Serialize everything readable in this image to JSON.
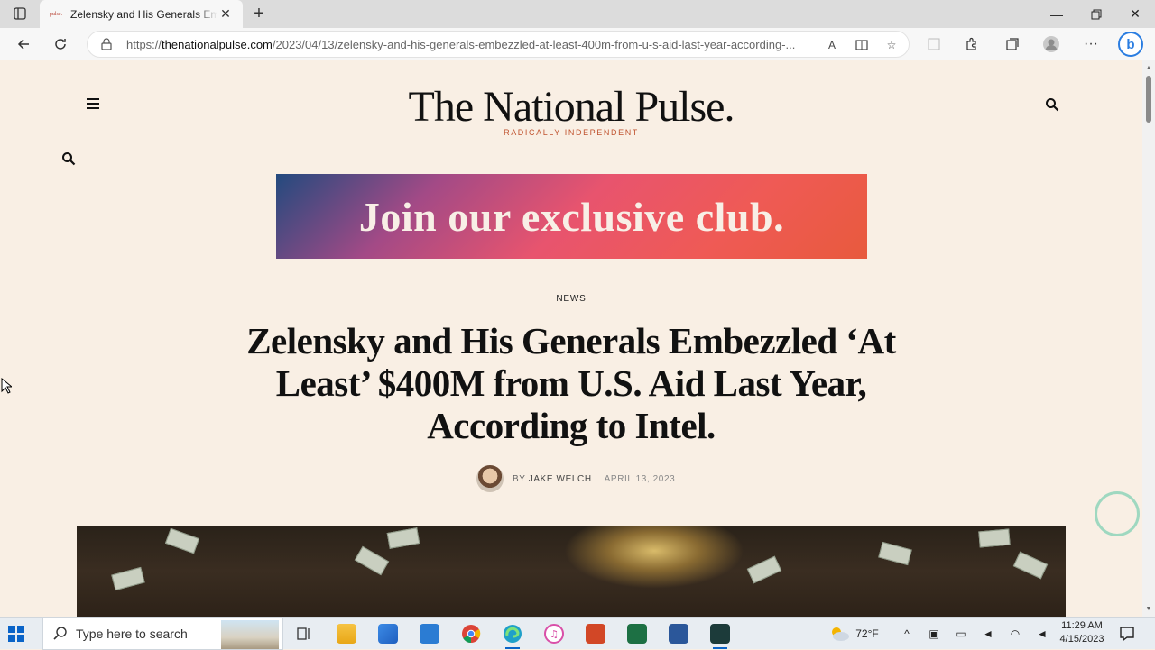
{
  "browser": {
    "tab": {
      "favicon_text": "pulse.",
      "title": "Zelensky and His Generals Embezzled"
    },
    "address": {
      "url_prefix": "https://",
      "url_domain": "thenationalpulse.com",
      "url_path": "/2023/04/13/zelensky-and-his-generals-embezzled-at-least-400m-from-u-s-aid-last-year-according-..."
    }
  },
  "page": {
    "logo": "The National Pulse.",
    "tagline": "RADICALLY INDEPENDENT",
    "banner_text": "Join our exclusive club.",
    "category": "NEWS",
    "headline": "Zelensky and His Generals Embezzled ‘At Least’ $400M from U.S. Aid Last Year, According to Intel.",
    "byline_prefix": "BY ",
    "author": "JAKE WELCH",
    "date": "APRIL 13, 2023"
  },
  "taskbar": {
    "search_placeholder": "Type here to search",
    "weather": "72°F",
    "time": "11:29 AM",
    "date": "4/15/2023"
  },
  "colors": {
    "page_background": "#f9efe4",
    "tagline": "#c0532f",
    "banner_gradient": [
      "#234a7e",
      "#e8546e",
      "#e85a3d"
    ]
  }
}
